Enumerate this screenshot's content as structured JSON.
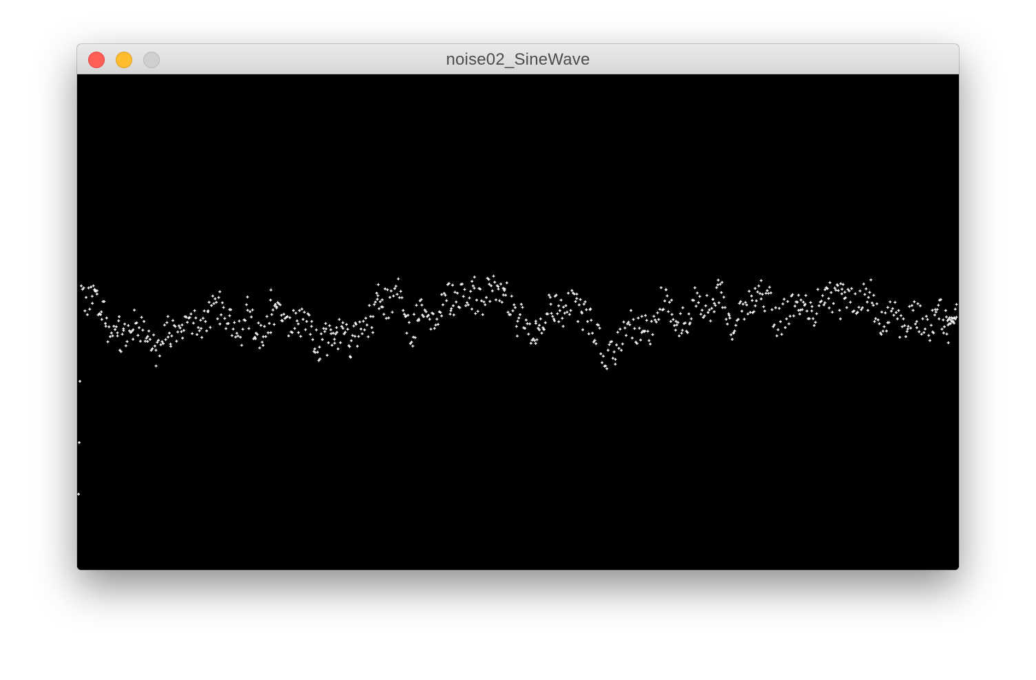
{
  "window": {
    "title": "noise02_SineWave",
    "controls": {
      "close": "close-button",
      "minimize": "minimize-button",
      "zoom": "zoom-button"
    },
    "colors": {
      "close": "#fe5f57",
      "minimize": "#febc2e",
      "zoom": "#cfcfcf",
      "titlebar": "#e3e3e3"
    }
  },
  "sketch": {
    "background": "#000000",
    "point_color": "#ffffff"
  }
}
